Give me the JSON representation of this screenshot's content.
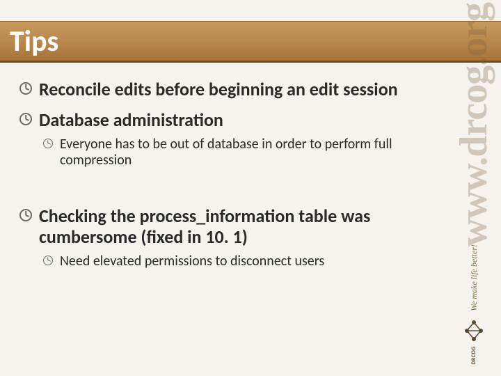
{
  "header": {
    "title": "Tips"
  },
  "bullets": [
    {
      "text": "Reconcile edits before beginning an edit session",
      "subs": []
    },
    {
      "text": "Database administration",
      "subs": [
        "Everyone has to be out of database in order to perform full compression"
      ]
    },
    {
      "text": "Checking the process_information table was cumbersome (fixed in 10. 1)",
      "subs": [
        "Need elevated permissions to disconnect users"
      ]
    }
  ],
  "branding": {
    "url": "www.drcog.org",
    "tagline": "We make life better!",
    "org": "DRCOG"
  }
}
